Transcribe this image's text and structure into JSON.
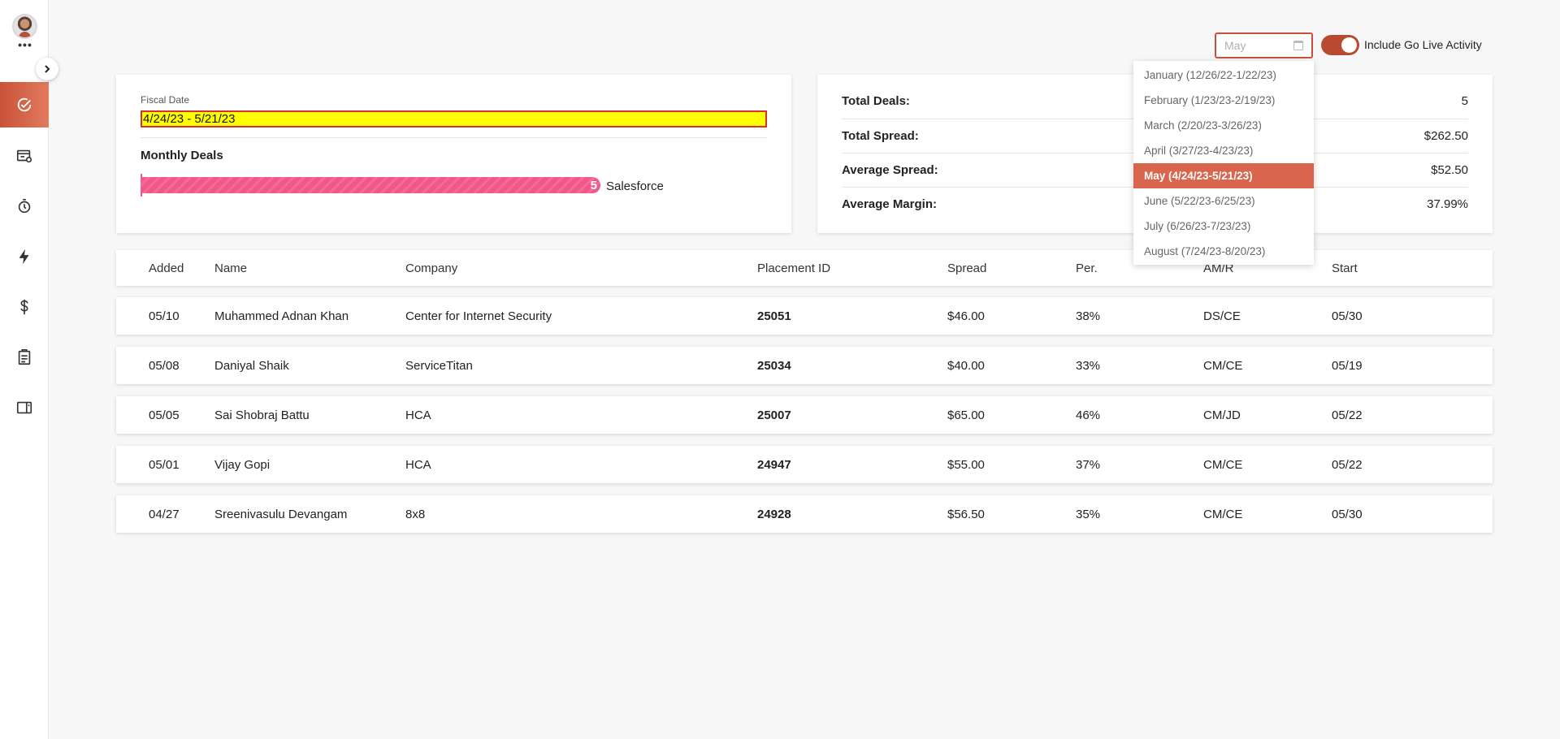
{
  "sidebar": {
    "more": "•••",
    "nav": [
      {
        "icon": "check-circle-icon",
        "active": true
      },
      {
        "icon": "id-card-icon",
        "active": false
      },
      {
        "icon": "clock-icon",
        "active": false
      },
      {
        "icon": "lightning-icon",
        "active": false
      },
      {
        "icon": "dollar-icon",
        "active": false
      },
      {
        "icon": "clipboard-icon",
        "active": false
      },
      {
        "icon": "book-icon",
        "active": false
      }
    ]
  },
  "filters": {
    "month_placeholder": "May",
    "toggle_on": true,
    "toggle_label": "Include Go Live Activity",
    "accent_color": "#c85238"
  },
  "month_dropdown": {
    "options": [
      "January (12/26/22-1/22/23)",
      "February (1/23/23-2/19/23)",
      "March (2/20/23-3/26/23)",
      "April (3/27/23-4/23/23)",
      "May (4/24/23-5/21/23)",
      "June (5/22/23-6/25/23)",
      "July (6/26/23-7/23/23)",
      "August (7/24/23-8/20/23)"
    ],
    "selected_index": 4
  },
  "summary": {
    "fiscal_label": "Fiscal Date",
    "fiscal_value": "4/24/23 - 5/21/23",
    "monthly_title": "Monthly Deals",
    "bar": {
      "value": "5",
      "label": "Salesforce",
      "fraction": 1.0,
      "color": "#f2578a"
    }
  },
  "stats": {
    "total_deals_label": "Total Deals:",
    "total_deals": "5",
    "total_spread_label": "Total Spread:",
    "total_spread": "$262.50",
    "avg_spread_label": "Average Spread:",
    "avg_spread": "$52.50",
    "avg_margin_label": "Average Margin:",
    "avg_margin": "37.99%"
  },
  "table": {
    "headers": [
      "Added",
      "Name",
      "Company",
      "Placement ID",
      "Spread",
      "Per.",
      "AM/R",
      "Start"
    ],
    "rows": [
      [
        "05/10",
        "Muhammed Adnan Khan",
        "Center for Internet Security",
        "25051",
        "$46.00",
        "38%",
        "DS/CE",
        "05/30"
      ],
      [
        "05/08",
        "Daniyal Shaik",
        "ServiceTitan",
        "25034",
        "$40.00",
        "33%",
        "CM/CE",
        "05/19"
      ],
      [
        "05/05",
        "Sai Shobraj Battu",
        "HCA",
        "25007",
        "$65.00",
        "46%",
        "CM/JD",
        "05/22"
      ],
      [
        "05/01",
        "Vijay Gopi",
        "HCA",
        "24947",
        "$55.00",
        "37%",
        "CM/CE",
        "05/22"
      ],
      [
        "04/27",
        "Sreenivasulu Devangam",
        "8x8",
        "24928",
        "$56.50",
        "35%",
        "CM/CE",
        "05/30"
      ]
    ]
  }
}
